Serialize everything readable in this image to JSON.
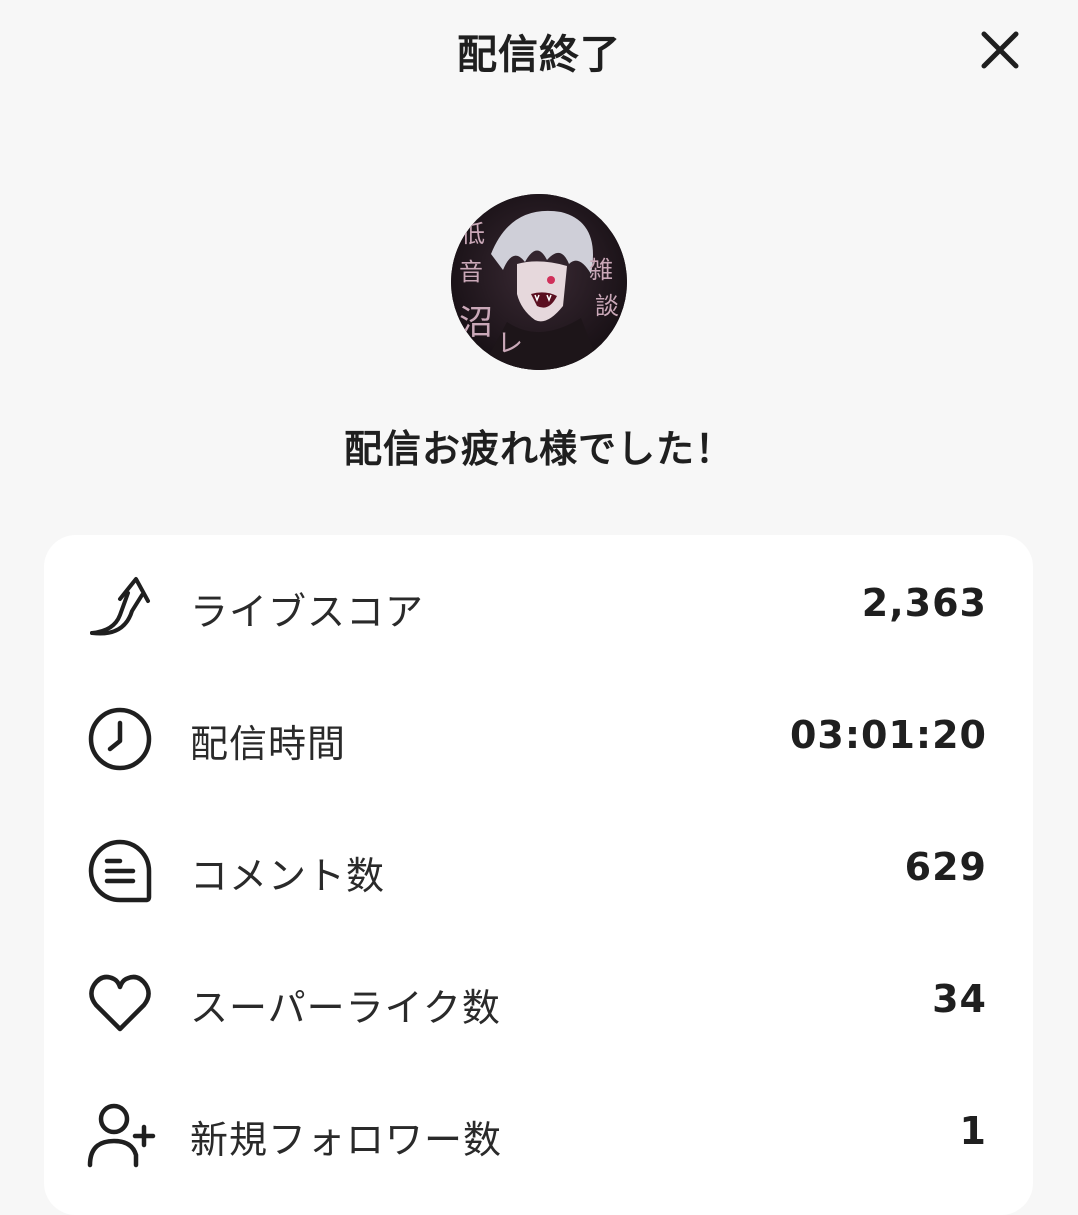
{
  "header": {
    "title": "配信終了",
    "close_icon": "close-icon"
  },
  "profile": {
    "avatar_text": [
      "低",
      "音",
      "沼",
      "レ",
      "雑",
      "談"
    ]
  },
  "message": "配信お疲れ様でした！",
  "stats": [
    {
      "icon": "trending-arrow-icon",
      "label": "ライブスコア",
      "value": "2,363"
    },
    {
      "icon": "clock-icon",
      "label": "配信時間",
      "value": "03:01:20"
    },
    {
      "icon": "comment-icon",
      "label": "コメント数",
      "value": "629"
    },
    {
      "icon": "heart-icon",
      "label": "スーパーライク数",
      "value": "34"
    },
    {
      "icon": "add-user-icon",
      "label": "新規フォロワー数",
      "value": "1"
    }
  ]
}
